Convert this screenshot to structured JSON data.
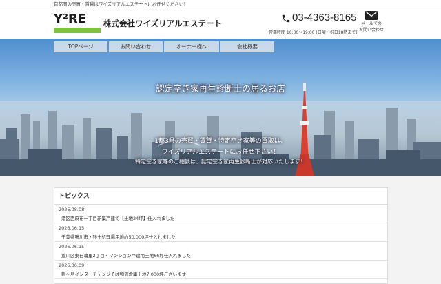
{
  "topbar": {
    "text": "首都圏の売買・賃貸はワイズリアルエステートにお任せください！"
  },
  "header": {
    "logo_text": "Y²RE",
    "company_name": "株式会社ワイズリアルエステート",
    "phone": "03-4363-8165",
    "hours": "営業時間 10:00～19:00 (日曜・祝日18時まで)",
    "mail_label_1": "メールでの",
    "mail_label_2": "お問い合わせ"
  },
  "nav": [
    {
      "label": "TOPページ"
    },
    {
      "label": "お問い合わせ"
    },
    {
      "label": "オーナー様へ"
    },
    {
      "label": "会社概要"
    }
  ],
  "hero": {
    "headline": "認定空き家再生診断士の居るお店",
    "line2": "1都3県の売買・賃貸・特定空き家等の買取は、",
    "line3": "ワイズリアルエステートにお任せ下さい！",
    "line4": "特定空き家等のご相談は、認定空き家再生診断士が対応いたします！"
  },
  "topics": {
    "title": "トピックス",
    "items": [
      {
        "date": "2026.08.08",
        "title": "港区西麻布一丁目新築戸建て【土地24坪】仕入れました"
      },
      {
        "date": "2026.06.15",
        "title": "千葉県鴨川市・残土処理場用地約50,000坪仕入れました"
      },
      {
        "date": "2026.06.15",
        "title": "荒川区東日暮里2丁目・マンション戸建用土地66坪仕入れました"
      },
      {
        "date": "2026.06.09",
        "title": "鶴ヶ島インターチェンジそば物流倉庫土地7,000坪ございます"
      }
    ]
  },
  "colors": {
    "accent_green": "#7dc242",
    "sky_blue": "#4f8fcf"
  }
}
